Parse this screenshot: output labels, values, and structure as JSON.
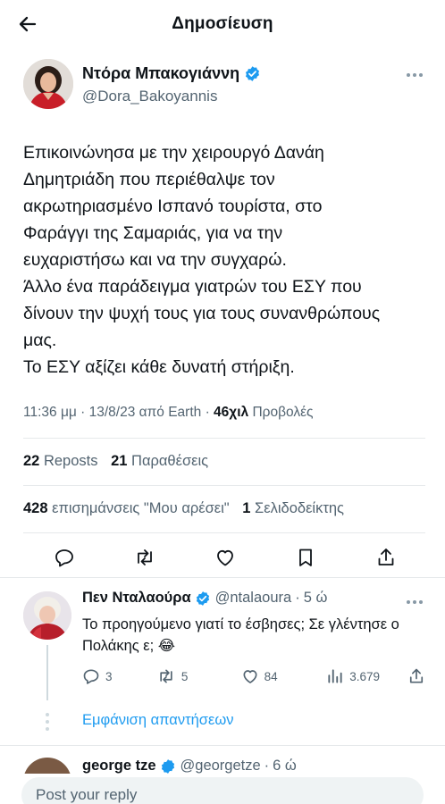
{
  "header": {
    "title": "Δημοσίευση"
  },
  "author": {
    "name": "Ντόρα Μπακογιάννη",
    "handle": "@Dora_Bakoyannis"
  },
  "tweet": {
    "lines": [
      "Επικοινώνησα με την χειρουργό Δανάη",
      "Δημητριάδη που περιέθαλψε τον",
      "ακρωτηριασμένο Ισπανό τουρίστα, στο",
      "Φαράγγι της Σαμαριάς, για να την",
      "ευχαριστήσω και να την συγχαρώ.",
      "Άλλο ένα παράδειγμα γιατρών του ΕΣΥ που",
      "δίνουν την ψυχή τους για τους συνανθρώπους",
      "μας.",
      "Το ΕΣΥ αξίζει κάθε δυνατή στήριξη."
    ],
    "time": "11:36 μμ",
    "date": "13/8/23",
    "source": "από Earth",
    "views_count": "46χιλ",
    "views_label": "Προβολές"
  },
  "stats": {
    "reposts_count": "22",
    "reposts_label": "Reposts",
    "quotes_count": "21",
    "quotes_label": "Παραθέσεις",
    "likes_count": "428",
    "likes_label": "επισημάνσεις \"Μου αρέσει\"",
    "bookmarks_count": "1",
    "bookmarks_label": "Σελιδοδείκτης"
  },
  "reply": {
    "name": "Πεν Νταλαούρα",
    "handle": "@ntalaoura",
    "time": "5 ώ",
    "text": "Το προηγούμενο γιατί το έσβησες; Σε γλέντησε ο Πολάκης ε; 😂",
    "replies": "3",
    "reposts": "5",
    "likes": "84",
    "views": "3.679"
  },
  "show_replies": "Εμφάνιση απαντήσεων",
  "next_reply": {
    "name": "george tze",
    "handle": "@georgetze",
    "time": "6 ώ"
  },
  "reply_box": {
    "placeholder": "Post your reply"
  },
  "colors": {
    "accent": "#1d9bf0",
    "text": "#0f1419",
    "secondary": "#536471",
    "divider": "#e6e9eb"
  }
}
